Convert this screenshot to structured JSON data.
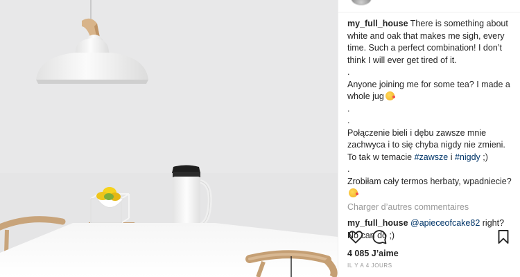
{
  "post": {
    "author": "my_full_house",
    "caption": {
      "p1": "There is something about white and oak that makes me sigh, every time. Such a perfect combination! I don’t think I will ever get tired of it.",
      "dot1": ".",
      "p2": "Anyone joining me for some tea? I made a whole jug",
      "dot2": ".",
      "dot3": ".",
      "p3_start": "Połączenie bieli i dębu zawsze mnie zachwyca i to się chyba nigdy nie zmieni. To tak w temacie",
      "p3_tag1": "#zawsze",
      "p3_join": "i",
      "p3_tag2": "#nigdy",
      "p3_end": ";)",
      "dot4": ".",
      "p4": "Zrobiłam cały termos herbaty, wpadniecie?"
    },
    "load_more": "Charger d’autres commentaires",
    "reply": {
      "author": "my_full_house",
      "mention": "@apieceofcake82",
      "text": "right? No can do ;)"
    },
    "likes": "4 085 J’aime",
    "timestamp": "IL Y A 4 JOURS"
  },
  "icons": {
    "like": "heart-icon",
    "comment": "comment-icon",
    "save": "bookmark-icon",
    "emoji": "kissing-face-emoji"
  },
  "colors": {
    "text": "#262626",
    "link": "#003569",
    "muted": "#999999",
    "border": "#efefef"
  }
}
